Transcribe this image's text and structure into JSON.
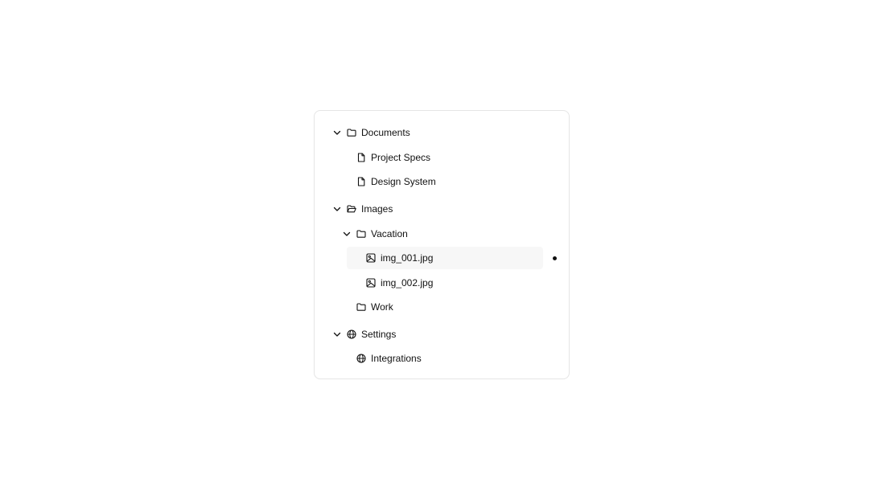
{
  "tree": {
    "documents": {
      "label": "Documents",
      "expanded": true,
      "icon": "folder-icon",
      "children": [
        {
          "label": "Project Specs",
          "icon": "file-icon"
        },
        {
          "label": "Design System",
          "icon": "file-icon"
        }
      ]
    },
    "images": {
      "label": "Images",
      "expanded": true,
      "icon": "folder-open-icon",
      "vacation": {
        "label": "Vacation",
        "expanded": true,
        "icon": "folder-icon",
        "children": [
          {
            "label": "img_001.jpg",
            "icon": "image-icon",
            "selected": true
          },
          {
            "label": "img_002.jpg",
            "icon": "image-icon",
            "selected": false
          }
        ]
      },
      "work": {
        "label": "Work",
        "icon": "folder-icon"
      }
    },
    "settings": {
      "label": "Settings",
      "expanded": true,
      "icon": "globe-icon",
      "children": [
        {
          "label": "Integrations",
          "icon": "globe-icon"
        }
      ]
    }
  },
  "colors": {
    "text": "#111111",
    "border": "#e5e5e5",
    "selected_background": "#f7f7f7"
  }
}
